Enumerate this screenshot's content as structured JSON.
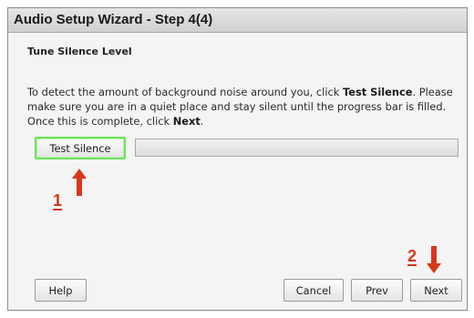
{
  "window": {
    "title": "Audio Setup Wizard - Step 4(4)"
  },
  "section": {
    "title": "Tune Silence Level"
  },
  "instructions": {
    "line1_pre": "To detect the amount of background noise around you, click ",
    "line1_bold": "Test Silence",
    "line1_post": ". Please make sure you are in a quiet place and stay silent until the progress bar is filled. Once this is complete, click ",
    "line2_bold": "Next",
    "line2_post": "."
  },
  "test_button": {
    "label": "Test Silence"
  },
  "progress": {
    "fraction": 0
  },
  "annotations": {
    "marker1_label": "1",
    "marker2_label": "2",
    "marker_color": "#d9361a"
  },
  "footer": {
    "help_label": "Help",
    "cancel_label": "Cancel",
    "prev_label": "Prev",
    "next_label": "Next"
  },
  "colors": {
    "focus_outline": "#6fe05a",
    "annotation_arrow": "#d9361a"
  }
}
